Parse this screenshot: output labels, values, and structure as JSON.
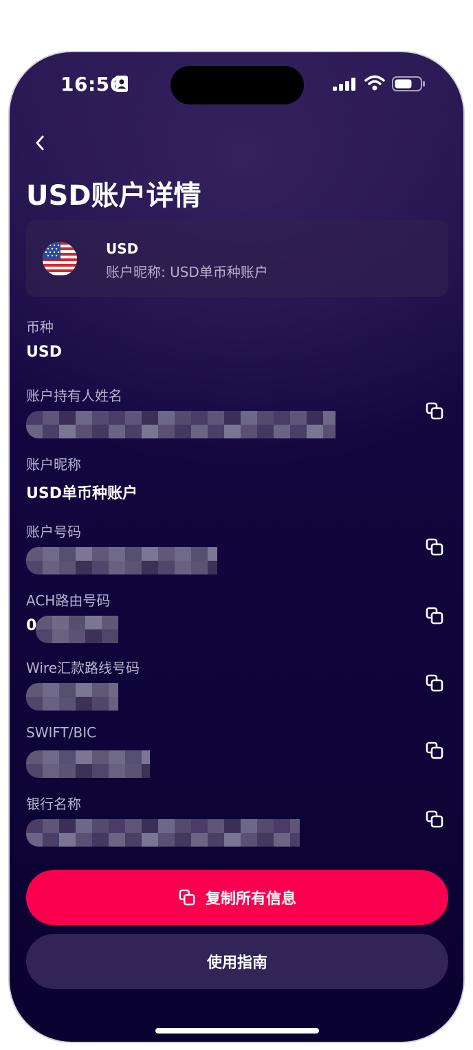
{
  "status_bar": {
    "time": "16:56"
  },
  "header": {
    "title": "USD账户详情"
  },
  "summary": {
    "currency_code": "USD",
    "nickname_line": "账户昵称: USD单币种账户",
    "flag_icon": "us-flag-icon"
  },
  "fields": {
    "currency": {
      "label": "币种",
      "value": "USD"
    },
    "holder_name": {
      "label": "账户持有人姓名"
    },
    "nickname": {
      "label": "账户昵称",
      "value": "USD单币种账户"
    },
    "account_number": {
      "label": "账户号码"
    },
    "ach_routing": {
      "label": "ACH路由号码",
      "visible_prefix": "0"
    },
    "wire_routing": {
      "label": "Wire汇款路线号码"
    },
    "swift": {
      "label": "SWIFT/BIC"
    },
    "bank_name": {
      "label": "银行名称"
    }
  },
  "actions": {
    "copy_all_label": "复制所有信息",
    "guide_label": "使用指南"
  },
  "colors": {
    "primary_button": "#fb004f",
    "secondary_button": "#332458",
    "background_top": "#261650",
    "background_bottom": "#0a0230"
  }
}
